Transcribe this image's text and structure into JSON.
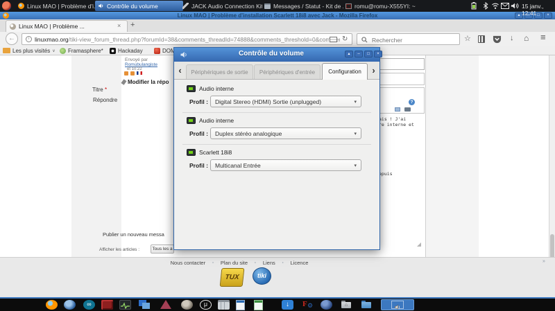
{
  "colors": {
    "accent": "#3d78c2",
    "panel_bg": "#17191c",
    "titlebar_blue": "#3a70b6",
    "dialog_bg": "#f0f0ef",
    "active_task": "#2d5d9d"
  },
  "glyphs": {
    "back": "←",
    "refresh": "↻",
    "menu": "≡",
    "star": "☆",
    "home": "⌂",
    "download": "↓",
    "caret": "▾",
    "chevron_down": "∨",
    "nav_left": "‹",
    "nav_right": "›",
    "roll": "▴",
    "min": "–",
    "max": "□",
    "close": "×",
    "tab_close": "×",
    "new_tab": "+",
    "help": "?",
    "info": "i",
    "infinity": "∞",
    "mu": "μ",
    "gear": "⚙",
    "sep_star": "⋆",
    "raquo": "»"
  },
  "top_panel": {
    "tasks": [
      "Linux MAO | Problème d'i...",
      "Contrôle du volume",
      "JACK Audio Connection Kit ...",
      "Messages / Statut - Kit de ...",
      "romu@romu-X555YI: ~"
    ],
    "clock": "15 janv., 12:41"
  },
  "browser": {
    "window_title": "Linux MAO | Problème d'installation Scarlett 18i8 avec Jack - Mozilla Firefox",
    "tab_title": "Linux MAO | Problème ...",
    "url_domain": "linuxmao.org",
    "url_path": "/tiki-view_forum_thread.php?forumId=38&comments_threadId=74888&comments_threshold=0&comment",
    "search_placeholder": "Rechercher",
    "bookmarks": [
      "Les plus visités",
      "Framasphere*",
      "Hackaday",
      "DOMOTRON"
    ]
  },
  "page": {
    "sent_by": "Envoyé par",
    "author": "Romubulangiste",
    "time": "et 10:22",
    "edit_reply": "Modifier la répo",
    "title_label": "Titre",
    "required_mark": "*",
    "reply_label": "Répondre",
    "mono_line1": "ais ! J'ai",
    "mono_line2": "re interne et",
    "mono_line3": "epuis",
    "publish": "Publier un nouveau messa",
    "filter_label": "Afficher les articles :",
    "filter_button": "Tous les a",
    "footer_links": [
      "Nous contacter",
      "Plan du site",
      "Liens",
      "Licence"
    ],
    "tux_logo": "TUX",
    "tiki_logo": "tiki"
  },
  "dialog": {
    "title": "Contrôle du volume",
    "tabs": [
      "Périphériques de sortie",
      "Périphériques d'entrée",
      "Configuration"
    ],
    "sections": [
      {
        "device": "Audio interne",
        "profile_label": "Profil :",
        "profile": "Digital Stereo (HDMI) Sortie (unplugged)"
      },
      {
        "device": "Audio interne",
        "profile_label": "Profil :",
        "profile": "Duplex stéréo analogique"
      },
      {
        "device": "Scarlett 18i8",
        "profile_label": "Profil :",
        "profile": "Multicanal Entrée"
      }
    ]
  }
}
